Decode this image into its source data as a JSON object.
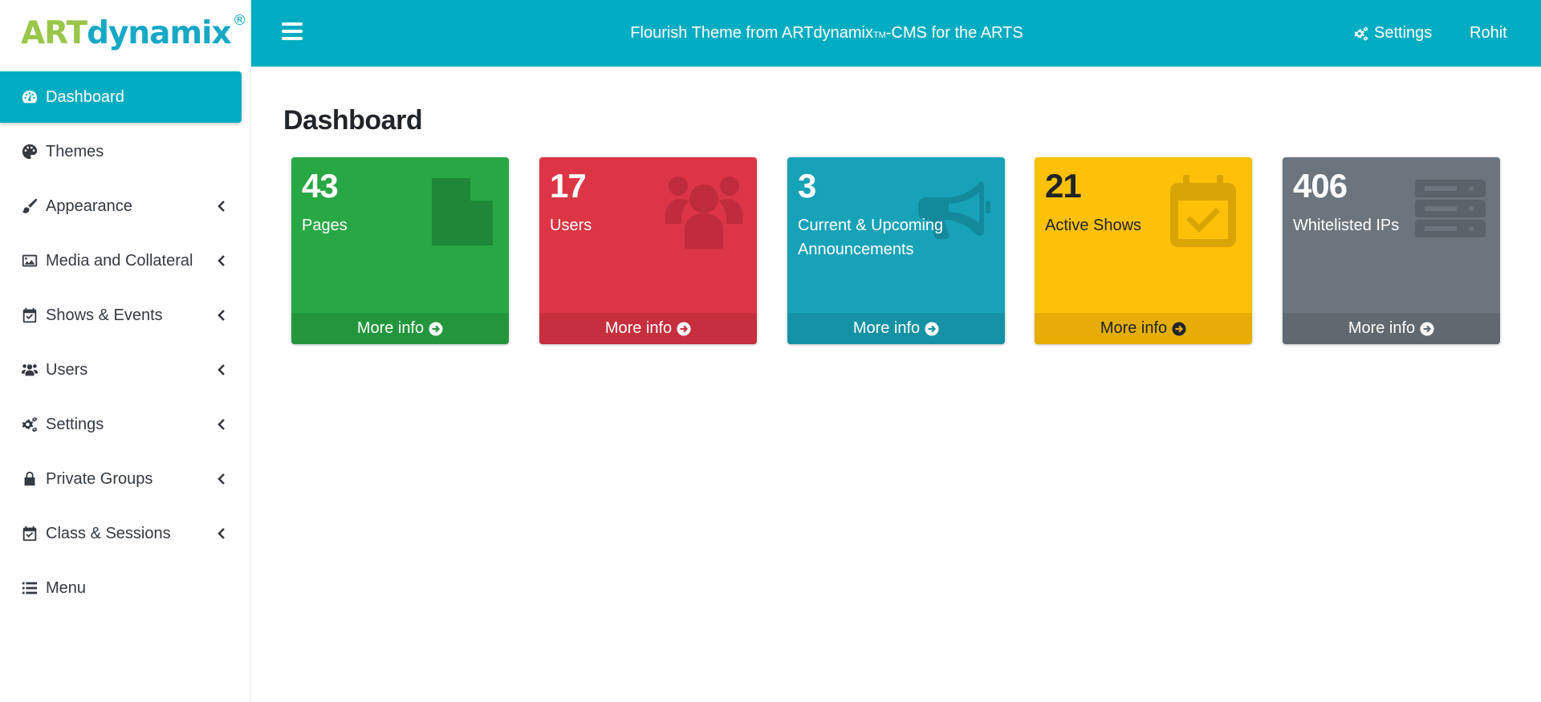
{
  "brand": {
    "part1": "ART",
    "part2": "dynamix",
    "reg": "®"
  },
  "topbar": {
    "title_main": "Flourish Theme from ARTdynamix",
    "title_tm": "TM",
    "title_rest": "-CMS for the ARTS",
    "settings_label": "Settings",
    "user_label": "Rohit"
  },
  "sidebar": {
    "items": [
      {
        "label": "Dashboard",
        "icon": "tachometer-icon",
        "active": true,
        "chevron": false
      },
      {
        "label": "Themes",
        "icon": "palette-icon",
        "active": false,
        "chevron": false
      },
      {
        "label": "Appearance",
        "icon": "paint-brush-icon",
        "active": false,
        "chevron": true
      },
      {
        "label": "Media and Collateral",
        "icon": "image-icon",
        "active": false,
        "chevron": true
      },
      {
        "label": "Shows & Events",
        "icon": "calendar-check-icon",
        "active": false,
        "chevron": true
      },
      {
        "label": "Users",
        "icon": "users-icon",
        "active": false,
        "chevron": true
      },
      {
        "label": "Settings",
        "icon": "cogs-icon",
        "active": false,
        "chevron": true
      },
      {
        "label": "Private Groups",
        "icon": "lock-icon",
        "active": false,
        "chevron": true
      },
      {
        "label": "Class & Sessions",
        "icon": "calendar-check-icon",
        "active": false,
        "chevron": true
      },
      {
        "label": "Menu",
        "icon": "list-icon",
        "active": false,
        "chevron": false
      }
    ]
  },
  "main": {
    "title": "Dashboard",
    "cards": [
      {
        "count": "43",
        "label": "Pages",
        "footer": "More info",
        "icon": "file-icon",
        "color": "#28a745"
      },
      {
        "count": "17",
        "label": "Users",
        "footer": "More info",
        "icon": "users-icon",
        "color": "#dc3545"
      },
      {
        "count": "3",
        "label": "Current & Upcoming Announcements",
        "footer": "More info",
        "icon": "bullhorn-icon",
        "color": "#17a2b8"
      },
      {
        "count": "21",
        "label": "Active Shows",
        "footer": "More info",
        "icon": "calendar-check-icon",
        "color": "#ffc107"
      },
      {
        "count": "406",
        "label": "Whitelisted IPs",
        "footer": "More info",
        "icon": "server-icon",
        "color": "#6c757d"
      }
    ]
  }
}
